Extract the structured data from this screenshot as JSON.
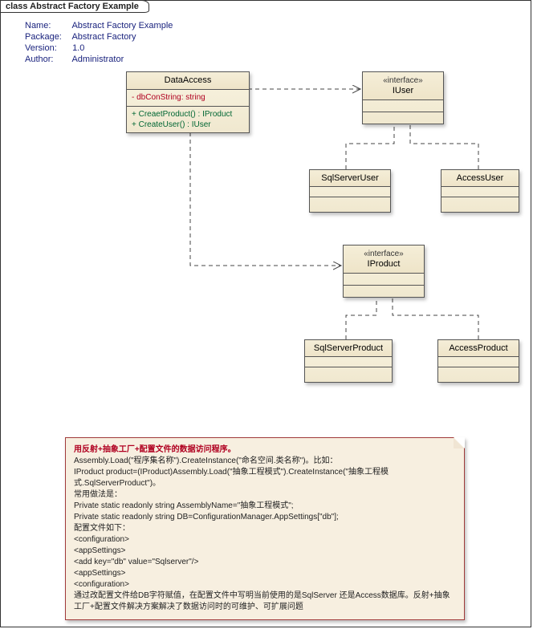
{
  "diagramTitle": "class Abstract Factory Example",
  "meta": {
    "nameLabel": "Name:",
    "nameValue": "Abstract Factory Example",
    "packageLabel": "Package:",
    "packageValue": "Abstract Factory",
    "versionLabel": "Version:",
    "versionValue": "1.0",
    "authorLabel": "Author:",
    "authorValue": "Administrator"
  },
  "dataAccess": {
    "name": "DataAccess",
    "attr1_vis": "-",
    "attr1_text": " dbConString: string",
    "op1": "+   CreaetProduct() : IProduct",
    "op2": "+   CreateUser() : IUser"
  },
  "iuser": {
    "stereotype": "«interface»",
    "name": "IUser"
  },
  "iproduct": {
    "stereotype": "«interface»",
    "name": "IProduct"
  },
  "leafClasses": {
    "sqlServerUser": "SqlServerUser",
    "accessUser": "AccessUser",
    "sqlServerProduct": "SqlServerProduct",
    "accessProduct": "AccessProduct"
  },
  "note": {
    "title": "用反射+抽象工厂+配置文件的数据访问程序。",
    "l1": "Assembly.Load(\"程序集名称\").CreateInstance(\"命名空间.类名称\")。比如：",
    "l2": "IProduct product=(IProduct)Assembly.Load(\"抽象工程模式\").CreateInstance(\"抽象工程模式.SqlServerProduct\")。",
    "l3": "常用做法是：",
    "l4": "Private static readonly string AssemblyName=\"抽象工程模式\";",
    "l5": "Private static readonly string DB=ConfigurationManager.AppSettings[\"db\"];",
    "l6": "配置文件如下：",
    "l7": "<configuration>",
    "l8": "    <appSettings>",
    "l9": "        <add key=\"db\" value=\"Sqlserver\"/>",
    "l10": "    <appSettings>",
    "l11": "<configuration>",
    "l12": "通过改配置文件给DB字符赋值，在配置文件中写明当前使用的是SqlServer 还是Access数据库。反射+抽象工厂+配置文件解决方案解决了数据访问时的可维护、可扩展问题"
  },
  "chart_data": {
    "type": "uml-class-diagram",
    "classes": [
      {
        "name": "DataAccess",
        "stereotype": null,
        "attributes": [
          {
            "visibility": "-",
            "text": "dbConString: string"
          }
        ],
        "operations": [
          {
            "visibility": "+",
            "text": "CreaetProduct() : IProduct"
          },
          {
            "visibility": "+",
            "text": "CreateUser() : IUser"
          }
        ]
      },
      {
        "name": "IUser",
        "stereotype": "interface",
        "attributes": [],
        "operations": []
      },
      {
        "name": "IProduct",
        "stereotype": "interface",
        "attributes": [],
        "operations": []
      },
      {
        "name": "SqlServerUser",
        "stereotype": null,
        "attributes": [],
        "operations": []
      },
      {
        "name": "AccessUser",
        "stereotype": null,
        "attributes": [],
        "operations": []
      },
      {
        "name": "SqlServerProduct",
        "stereotype": null,
        "attributes": [],
        "operations": []
      },
      {
        "name": "AccessProduct",
        "stereotype": null,
        "attributes": [],
        "operations": []
      }
    ],
    "relationships": [
      {
        "from": "DataAccess",
        "to": "IUser",
        "type": "dependency"
      },
      {
        "from": "DataAccess",
        "to": "IProduct",
        "type": "dependency"
      },
      {
        "from": "SqlServerUser",
        "to": "IUser",
        "type": "realization"
      },
      {
        "from": "AccessUser",
        "to": "IUser",
        "type": "realization"
      },
      {
        "from": "SqlServerProduct",
        "to": "IProduct",
        "type": "realization"
      },
      {
        "from": "AccessProduct",
        "to": "IProduct",
        "type": "realization"
      }
    ]
  }
}
